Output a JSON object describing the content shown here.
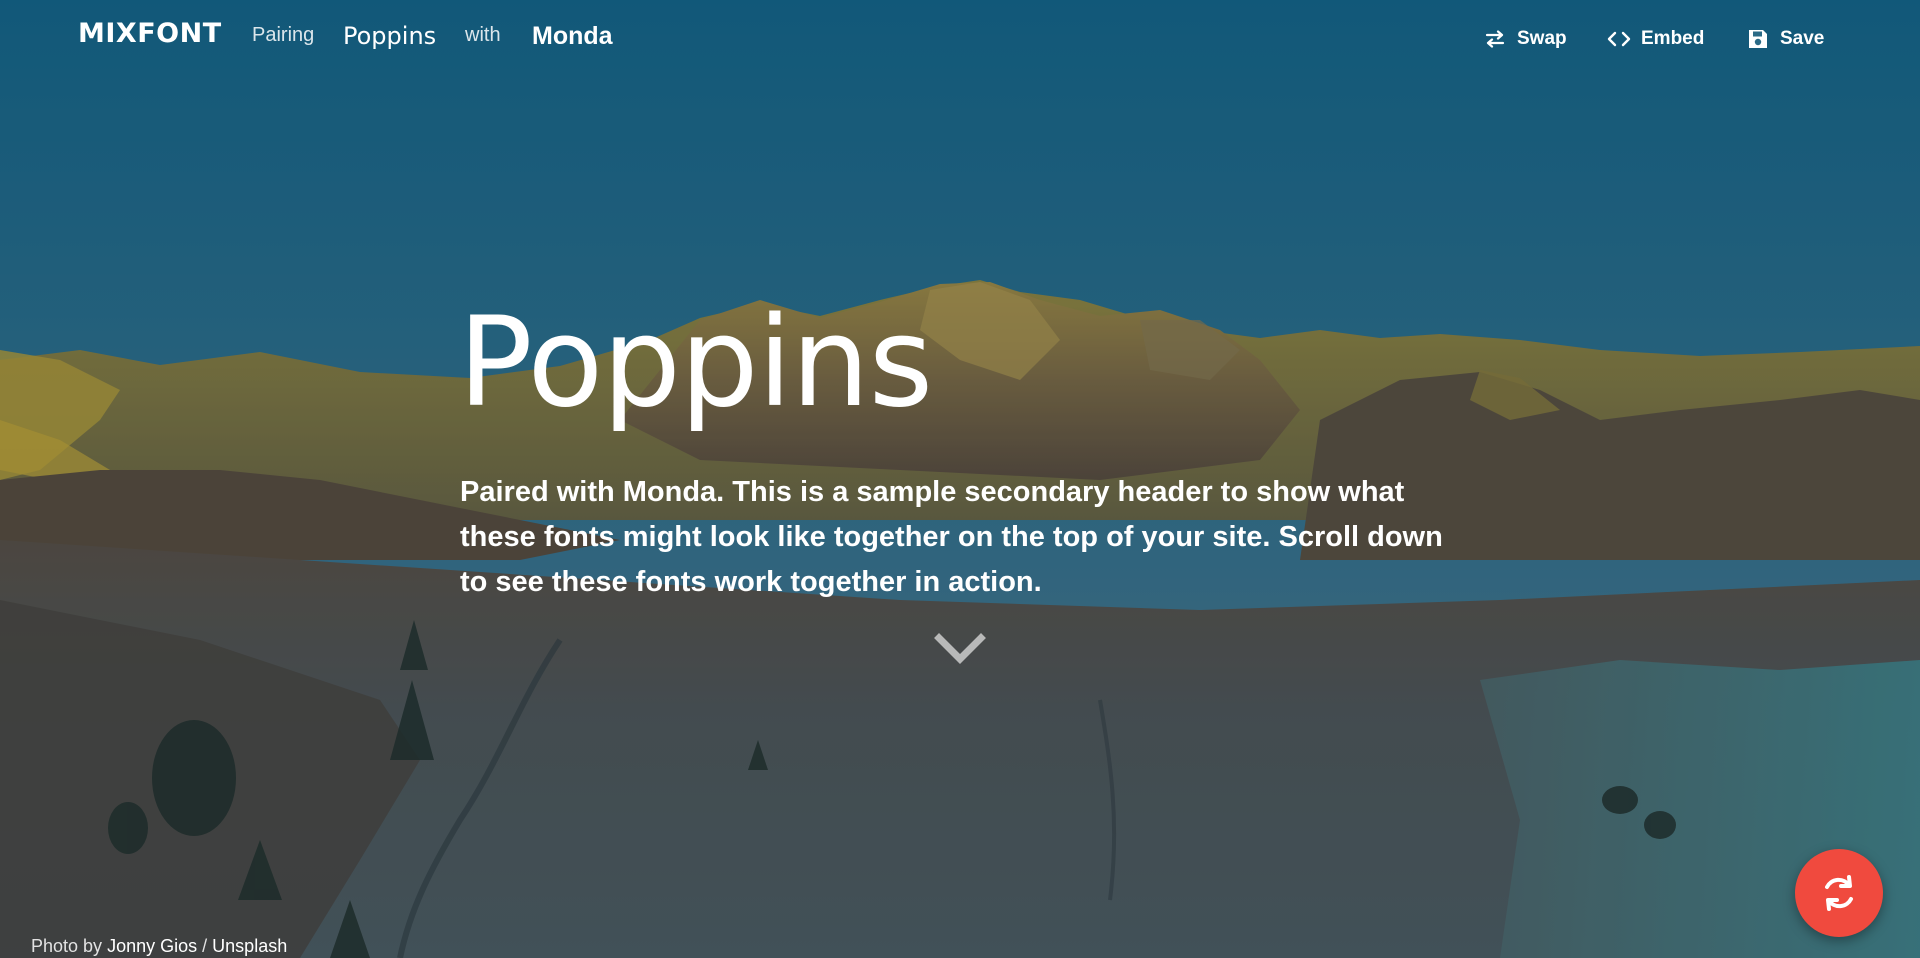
{
  "nav": {
    "logo": "MIXFONT",
    "pairing_label": "Pairing",
    "primary_font": "Poppins",
    "with_label": "with",
    "secondary_font": "Monda",
    "actions": {
      "swap": "Swap",
      "embed": "Embed",
      "save": "Save"
    }
  },
  "hero": {
    "headline": "Poppins",
    "subheadline": "Paired with Monda. This is a sample secondary header to show what these fonts might look like together on the top of your site. Scroll down to see these fonts work together in action."
  },
  "credit": {
    "prefix": "Photo by",
    "author": "Jonny Gios",
    "separator": "/",
    "source": "Unsplash"
  },
  "icons": {
    "swap": "swap-arrows-icon",
    "embed": "code-brackets-icon",
    "save": "floppy-disk-icon",
    "scroll": "chevron-down-icon",
    "shuffle": "refresh-icon"
  },
  "colors": {
    "fab_background": "#f04a3e",
    "text": "#ffffff"
  }
}
